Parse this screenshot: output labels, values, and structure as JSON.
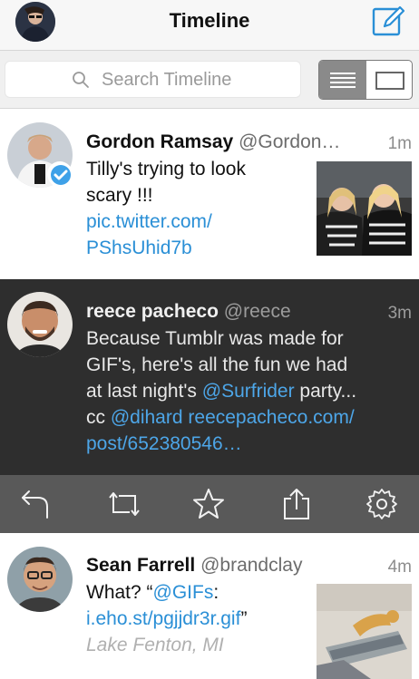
{
  "header": {
    "title": "Timeline"
  },
  "search": {
    "placeholder": "Search Timeline"
  },
  "tweets": [
    {
      "name": "Gordon Ramsay",
      "handle": "@Gordon…",
      "time": "1m",
      "text_line1": "Tilly's trying to look",
      "text_line2": "scary !!!",
      "link_line1": "pic.twitter.com/",
      "link_line2": "PShsUhid7b"
    },
    {
      "name": "reece pacheco",
      "handle": "@reece",
      "time": "3m",
      "line1": "Because Tumblr was made for",
      "line2": "GIF's, here's all the fun we had",
      "line3_pre": "at last night's ",
      "line3_link": "@Surfrider",
      "line3_post": " party...",
      "line4_pre": "cc ",
      "line4_link1": "@dihard",
      "line4_link2": "reecepacheco.com/",
      "line5_link": "post/652380546…"
    },
    {
      "name": "Sean Farrell",
      "handle": "@brandclay",
      "time": "4m",
      "line1_pre": "What? “",
      "line1_link": "@GIFs",
      "line1_post": ":",
      "line2_link": "i.eho.st/pgjjdr3r.gif",
      "line2_post": "”",
      "location": "Lake Fenton, MI"
    }
  ],
  "actions": [
    "reply-icon",
    "retweet-icon",
    "favorite-icon",
    "share-icon",
    "settings-icon"
  ],
  "colors": {
    "link": "#2a8fd6",
    "accent": "#2a8fd6",
    "selected_bg": "#2e2e2e",
    "action_bar": "#595959",
    "verified": "#3ea1e8"
  }
}
